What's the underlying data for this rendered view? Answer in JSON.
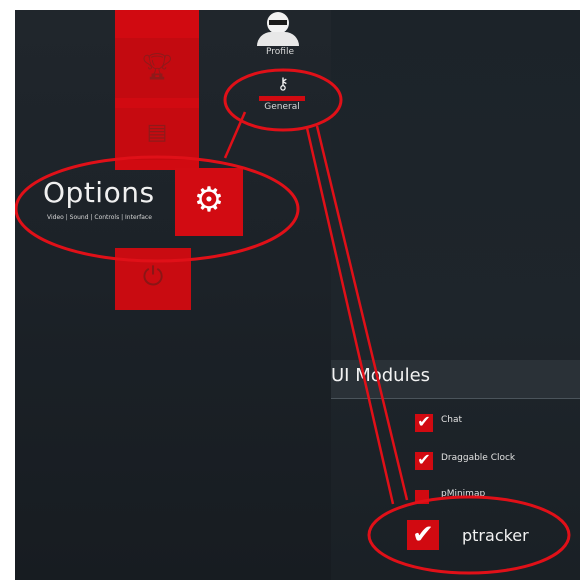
{
  "menu": {
    "profile_label": "Profile",
    "general_label": "General",
    "options_title": "Options",
    "options_subtitle": "Video | Sound | Controls | Interface",
    "icons": {
      "trophy": "trophy-icon",
      "tile2": "menu-icon",
      "gear": "gear-icon",
      "power": "power-icon",
      "profile": "user-icon",
      "general": "keys-icon"
    }
  },
  "modules_panel": {
    "title": "UI Modules",
    "items": [
      {
        "label": "Chat",
        "checked": true
      },
      {
        "label": "Draggable Clock",
        "checked": true
      },
      {
        "label": "pMinimap",
        "checked": false
      },
      {
        "label": "ptracker",
        "checked": true
      }
    ]
  },
  "colors": {
    "accent_red": "#d10a11",
    "annotation_red": "#e01018",
    "background": "#1d2329"
  }
}
